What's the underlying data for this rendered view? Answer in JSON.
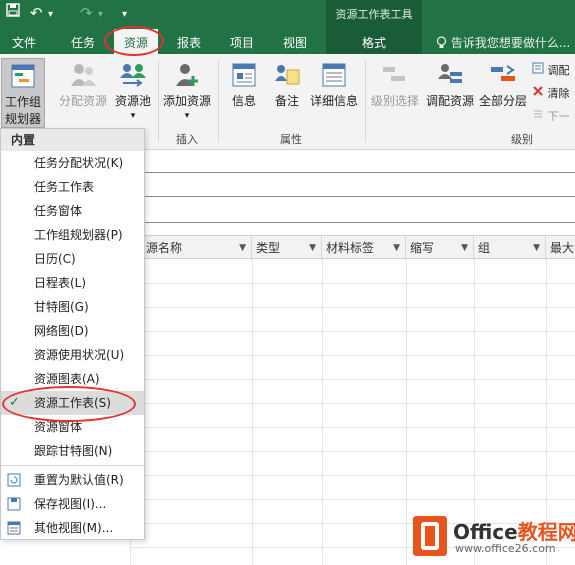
{
  "qat": {
    "undo": "↶",
    "redo": "↷",
    "customize": "▾"
  },
  "context_tab": {
    "title": "资源工作表工具",
    "tab": "格式"
  },
  "tabs": [
    "文件",
    "任务",
    "资源",
    "报表",
    "项目",
    "视图"
  ],
  "active_tab": "资源",
  "tell_me": "告诉我您想要做什么...",
  "ribbon": {
    "team_planner": {
      "line1": "工作组",
      "line2": "规划器 ▾"
    },
    "assign_resources": "分配资源",
    "resource_pool": "资源池",
    "add_resources": "添加资源",
    "information": "信息",
    "notes": "备注",
    "details": "详细信息",
    "level_selection": "级别选择",
    "level_resource": "调配资源",
    "level_all": "全部分层",
    "leveling_options": "调配",
    "clear_leveling": "清除",
    "next_overallocation": "下一",
    "groups": {
      "insert": "插入",
      "properties": "属性",
      "level": "级别"
    },
    "dropdown_arrow": "▾"
  },
  "menu": {
    "header": "内置",
    "items": [
      "任务分配状况(K)",
      "任务工作表",
      "任务窗体",
      "工作组规划器(P)",
      "日历(C)",
      "日程表(L)",
      "甘特图(G)",
      "网络图(D)",
      "资源使用状况(U)",
      "资源图表(A)",
      "资源工作表(S)",
      "资源窗体",
      "跟踪甘特图(N)"
    ],
    "checked_item": "资源工作表(S)",
    "check_mark": "✓",
    "actions": [
      "重置为默认值(R)",
      "保存视图(I)...",
      "其他视图(M)..."
    ]
  },
  "columns": [
    "资源名称",
    "类型",
    "材料标签",
    "缩写",
    "组",
    "最大"
  ],
  "column_dropdown": "▼",
  "logo": {
    "brand_main": "Office",
    "brand_accent": "教程网",
    "url": "www.office26.com"
  },
  "colors": {
    "brand_green": "#217346",
    "annotation_red": "#e2342f",
    "logo_orange": "#e8541e"
  }
}
